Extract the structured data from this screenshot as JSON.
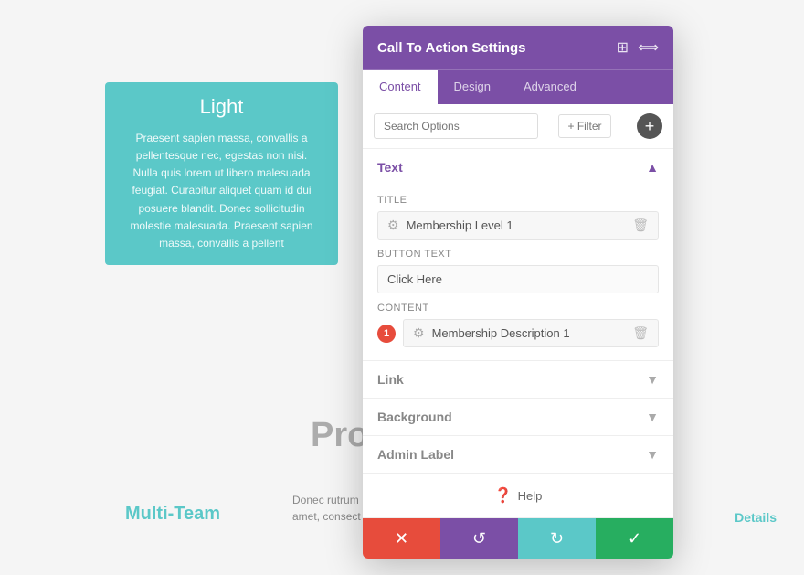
{
  "background": {
    "card": {
      "title": "Light",
      "text": "Praesent sapien massa, convallis a pellentesque nec, egestas non nisi. Nulla quis lorem ut libero malesuada feugiat. Curabitur aliquet quam id dui posuere blandit. Donec sollicitudin molestie malesuada. Praesent sapien massa, convallis a pellent"
    },
    "page_title": "Pro",
    "team_label": "Multi-Team",
    "donec_text": "Donec rutrum amet, consect",
    "details_label": "Details"
  },
  "modal": {
    "header": {
      "title": "Call To Action Settings",
      "icon1": "⊞",
      "icon2": "⟺"
    },
    "tabs": [
      {
        "label": "Content",
        "active": true
      },
      {
        "label": "Design",
        "active": false
      },
      {
        "label": "Advanced",
        "active": false
      }
    ],
    "search": {
      "placeholder": "Search Options",
      "filter_label": "+ Filter"
    },
    "sections": {
      "text": {
        "label": "Text",
        "expanded": true,
        "title_field": {
          "label": "Title",
          "value": "Membership Level 1"
        },
        "button_text_field": {
          "label": "Button Text",
          "value": "Click Here"
        },
        "content_field": {
          "label": "Content",
          "badge": "1",
          "value": "Membership Description 1"
        }
      },
      "link": {
        "label": "Link",
        "expanded": false
      },
      "background": {
        "label": "Background",
        "expanded": false
      },
      "admin_label": {
        "label": "Admin Label",
        "expanded": false
      }
    },
    "help": {
      "label": "Help"
    },
    "footer": {
      "close_icon": "✕",
      "undo_icon": "↺",
      "redo_icon": "↻",
      "check_icon": "✓"
    }
  }
}
